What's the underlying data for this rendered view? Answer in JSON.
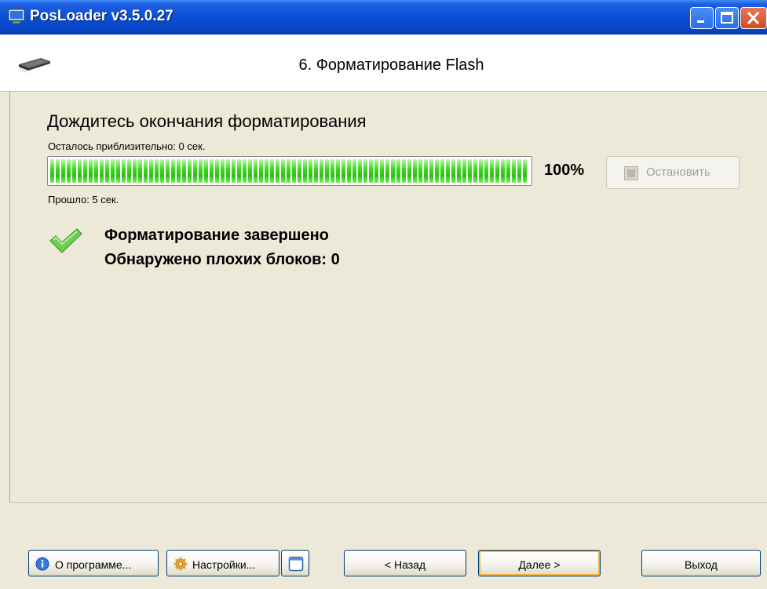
{
  "window": {
    "title": "PosLoader v3.5.0.27",
    "title_bar_color": "#0a4fd4"
  },
  "header": {
    "step_title": "6. Форматирование Flash",
    "icon": "chip-icon"
  },
  "main": {
    "heading": "Дождитесь окончания форматирования",
    "remaining_text": "Осталось приблизительно: 0 сек.",
    "progress_percent": 100,
    "progress_label": "100%",
    "progress_color": "#35d61a",
    "stop_button_label": "Остановить",
    "stop_button_enabled": false,
    "elapsed_text": "Прошло: 5 сек.",
    "status_icon": "checkmark-icon",
    "status_line1": "Форматирование завершено",
    "status_line2": "Обнаружено плохих блоков: 0"
  },
  "footer": {
    "about_label": "О программе...",
    "settings_label": "Настройки...",
    "back_label": "< Назад",
    "next_label": "Далее >",
    "exit_label": "Выход"
  }
}
